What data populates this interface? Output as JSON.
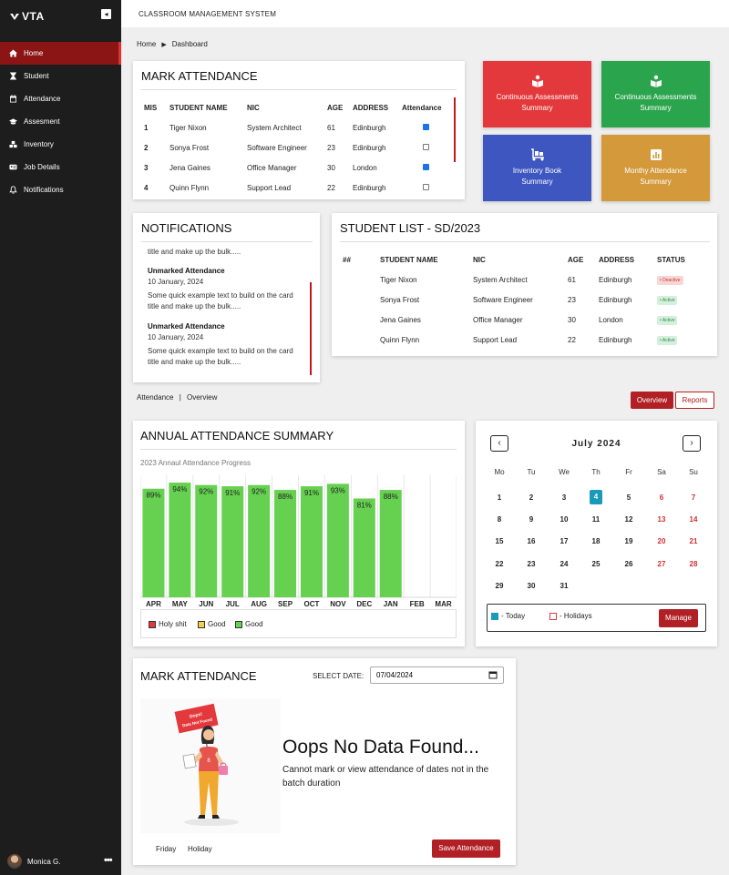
{
  "brand": {
    "logo_text": "VTA"
  },
  "sidebar": {
    "items": [
      {
        "label": "Home",
        "icon": "home-icon"
      },
      {
        "label": "Student",
        "icon": "hourglass-icon"
      },
      {
        "label": "Attendance",
        "icon": "calendar-icon"
      },
      {
        "label": "Assesment",
        "icon": "graduation-cap-icon"
      },
      {
        "label": "Inventory",
        "icon": "boxes-icon"
      },
      {
        "label": "Job Details",
        "icon": "id-card-icon"
      },
      {
        "label": "Notifications",
        "icon": "bell-icon"
      }
    ],
    "user_name": "Monica G.",
    "more_label": "•••"
  },
  "header": {
    "app_title": "CLASSROOM MANAGEMENT SYSTEM"
  },
  "breadcrumb": {
    "home": "Home",
    "current": "Dashboard"
  },
  "mark_attendance": {
    "title": "MARK ATTENDANCE",
    "columns": [
      "MIS",
      "STUDENT NAME",
      "NIC",
      "AGE",
      "ADDRESS",
      "Attendance"
    ],
    "rows": [
      {
        "mis": "1",
        "name": "Tiger Nixon",
        "nic": "System Architect",
        "age": "61",
        "address": "Edinburgh",
        "checked": true
      },
      {
        "mis": "2",
        "name": "Sonya Frost",
        "nic": "Software Engineer",
        "age": "23",
        "address": "Edinburgh",
        "checked": false
      },
      {
        "mis": "3",
        "name": "Jena Gaines",
        "nic": "Office Manager",
        "age": "30",
        "address": "London",
        "checked": true
      },
      {
        "mis": "4",
        "name": "Quinn Flynn",
        "nic": "Support Lead",
        "age": "22",
        "address": "Edinburgh",
        "checked": false
      }
    ]
  },
  "tiles": [
    {
      "line1": "Continuous Assessments",
      "line2": "Summary",
      "color": "#e3393c",
      "icon": "book-reader-icon"
    },
    {
      "line1": "Continuous Assessments",
      "line2": "Summary",
      "color": "#2ba54d",
      "icon": "book-reader-icon"
    },
    {
      "line1": "Inventory Book",
      "line2": "Summary",
      "color": "#3e56c0",
      "icon": "dolly-icon"
    },
    {
      "line1": "Monthy Attendance",
      "line2": "Summary",
      "color": "#d4993b",
      "icon": "chart-icon"
    }
  ],
  "notifications": {
    "title": "NOTIFICATIONS",
    "partial_text": "title and make up the bulk.....",
    "items": [
      {
        "heading": "Unmarked Attendance",
        "date": "10 January, 2024",
        "body1": "Some quick example text to build on the card",
        "body2": "title and make up the bulk....."
      },
      {
        "heading": "Unmarked Attendance",
        "date": "10 January, 2024",
        "body1": "Some quick example text to build on the card",
        "body2": "title and make up the bulk....."
      }
    ]
  },
  "student_list": {
    "title": "STUDENT LIST - SD/2023",
    "columns": [
      "##",
      "STUDENT NAME",
      "NIC",
      "AGE",
      "ADDRESS",
      "STATUS"
    ],
    "rows": [
      {
        "name": "Tiger Nixon",
        "nic": "System Architect",
        "age": "61",
        "address": "Edinburgh",
        "status": "• Deactive",
        "active": false
      },
      {
        "name": "Sonya Frost",
        "nic": "Software Engineer",
        "age": "23",
        "address": "Edinburgh",
        "status": "• Active",
        "active": true
      },
      {
        "name": "Jena Gaines",
        "nic": "Office Manager",
        "age": "30",
        "address": "London",
        "status": "• Active",
        "active": true
      },
      {
        "name": "Quinn Flynn",
        "nic": "Support Lead",
        "age": "22",
        "address": "Edinburgh",
        "status": "• Active",
        "active": true
      }
    ]
  },
  "section_nav": {
    "left": "Attendance",
    "right": "Overview",
    "overview_btn": "Overview",
    "reports_btn": "Reports"
  },
  "annual_summary": {
    "title": "ANNUAL ATTENDANCE SUMMARY"
  },
  "chart_data": {
    "type": "bar",
    "title": "2023 Annaul Attendance Progress",
    "categories": [
      "APR",
      "MAY",
      "JUN",
      "JUL",
      "AUG",
      "SEP",
      "OCT",
      "NOV",
      "DEC",
      "JAN",
      "FEB",
      "MAR"
    ],
    "values": [
      89,
      94,
      92,
      91,
      92,
      88,
      91,
      93,
      81,
      88,
      null,
      null
    ],
    "value_labels": [
      "89%",
      "94%",
      "92%",
      "91%",
      "92%",
      "88%",
      "91%",
      "93%",
      "81%",
      "88%",
      "",
      ""
    ],
    "ylim": [
      0,
      100
    ],
    "bar_color": "#66d150",
    "legend": [
      {
        "label": "Holy shit",
        "color": "#e3393c"
      },
      {
        "label": "Good",
        "color": "#f2d04a"
      },
      {
        "label": "Good",
        "color": "#66d150"
      }
    ]
  },
  "calendar": {
    "month_label": "July 2024",
    "prev": "‹",
    "next": "›",
    "weekdays": [
      "Mo",
      "Tu",
      "We",
      "Th",
      "Fr",
      "Sa",
      "Su"
    ],
    "weeks": [
      [
        "1",
        "2",
        "3",
        "4",
        "5",
        "6",
        "7"
      ],
      [
        "8",
        "9",
        "10",
        "11",
        "12",
        "13",
        "14"
      ],
      [
        "15",
        "16",
        "17",
        "18",
        "19",
        "20",
        "21"
      ],
      [
        "22",
        "23",
        "24",
        "25",
        "26",
        "27",
        "28"
      ],
      [
        "29",
        "30",
        "31",
        "",
        "",
        "",
        ""
      ]
    ],
    "today": "4",
    "today_label": "- Today",
    "holidays_label": "- Holidays",
    "manage_btn": "Manage",
    "today_color": "#1a9aba"
  },
  "mark_attendance_2": {
    "title": "MARK ATTENDANCE",
    "date_label": "SELECT DATE:",
    "date_value": "07/04/2024",
    "empty_title": "Oops No Data Found...",
    "empty_line1": "Cannot mark or view attendance of dates not in the",
    "empty_line2": "batch duration",
    "sign_line1": "Oops!",
    "sign_line2": "Data Not Found",
    "footer_day": "Friday",
    "footer_status": "Holiday",
    "save_btn": "Save Attendance"
  }
}
